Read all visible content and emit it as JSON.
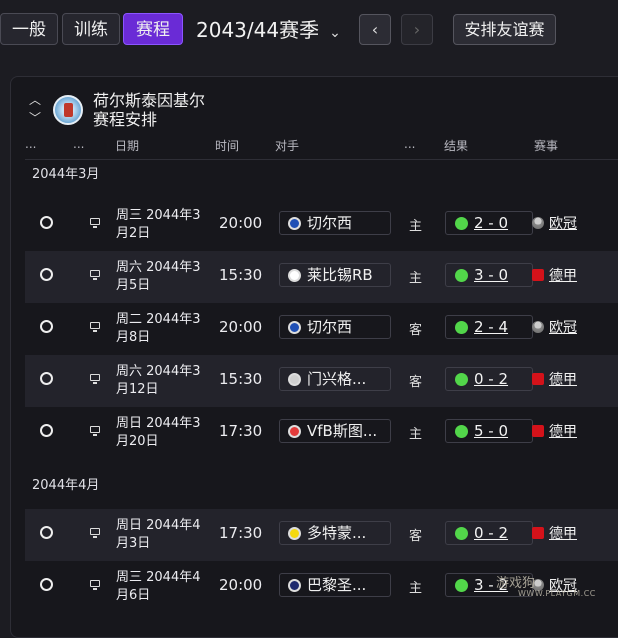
{
  "topbar": {
    "tabs": [
      {
        "label": "一般",
        "active": false
      },
      {
        "label": "训练",
        "active": false
      },
      {
        "label": "赛程",
        "active": true
      }
    ],
    "season": "2043/44赛季",
    "prev_icon": "chevron-left-icon",
    "next_icon": "chevron-right-icon",
    "friendly_label": "安排友谊赛"
  },
  "panel": {
    "club_name": "荷尔斯泰因基尔",
    "title": "赛程安排",
    "columns": {
      "c1": "...",
      "c2": "...",
      "date": "日期",
      "time": "时间",
      "opponent": "对手",
      "c6": "...",
      "result": "结果",
      "competition": "赛事"
    }
  },
  "months": [
    "2044年3月",
    "2044年4月"
  ],
  "matches": [
    {
      "date": "周三 2044年3月2日",
      "time": "20:00",
      "opponent": "切尔西",
      "venue": "主",
      "score": "2 - 0",
      "competition": "欧冠",
      "comp_type": "ucl",
      "badge": "#1f4fb5"
    },
    {
      "date": "周六 2044年3月5日",
      "time": "15:30",
      "opponent": "莱比锡RB",
      "venue": "主",
      "score": "3 - 0",
      "competition": "德甲",
      "comp_type": "bl",
      "badge": "#ffffff"
    },
    {
      "date": "周二 2044年3月8日",
      "time": "20:00",
      "opponent": "切尔西",
      "venue": "客",
      "score": "2 - 4",
      "competition": "欧冠",
      "comp_type": "ucl",
      "badge": "#1f4fb5"
    },
    {
      "date": "周六 2044年3月12日",
      "time": "15:30",
      "opponent": "门兴格...",
      "venue": "客",
      "score": "0 - 2",
      "competition": "德甲",
      "comp_type": "bl",
      "badge": "#cfcfcf"
    },
    {
      "date": "周日 2044年3月20日",
      "time": "17:30",
      "opponent": "VfB斯图...",
      "venue": "主",
      "score": "5 - 0",
      "competition": "德甲",
      "comp_type": "bl",
      "badge": "#e23b3b"
    },
    {
      "date": "周日 2044年4月3日",
      "time": "17:30",
      "opponent": "多特蒙...",
      "venue": "客",
      "score": "0 - 2",
      "competition": "德甲",
      "comp_type": "bl",
      "badge": "#f5d90f"
    },
    {
      "date": "周三 2044年4月6日",
      "time": "20:00",
      "opponent": "巴黎圣...",
      "venue": "主",
      "score": "3 - 2",
      "competition": "欧冠",
      "comp_type": "ucl",
      "badge": "#1e2a6e"
    }
  ],
  "watermark": {
    "text": "游戏狗",
    "sub": "WWW.PLAYGM.CC"
  },
  "colors": {
    "accent": "#6a2bd6",
    "win": "#52d64a",
    "row_alt": "#23232b"
  }
}
